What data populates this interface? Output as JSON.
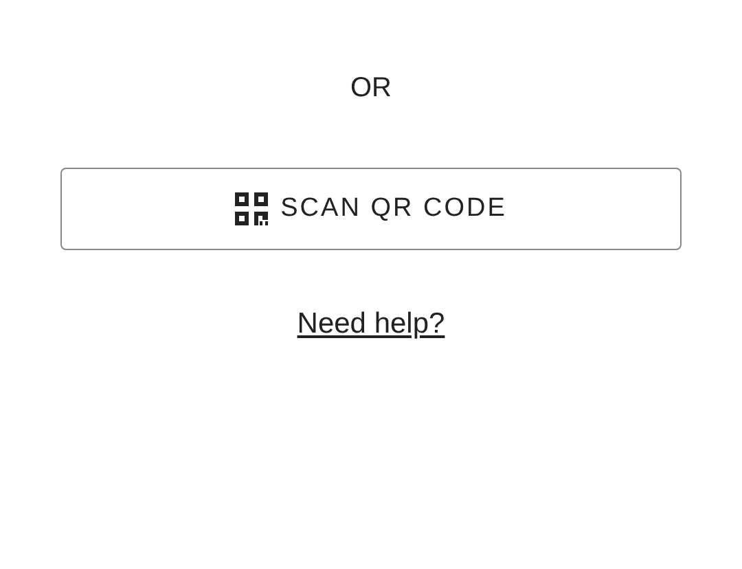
{
  "divider_text": "OR",
  "scan_button": {
    "label": "SCAN QR CODE"
  },
  "help_link": "Need help?"
}
